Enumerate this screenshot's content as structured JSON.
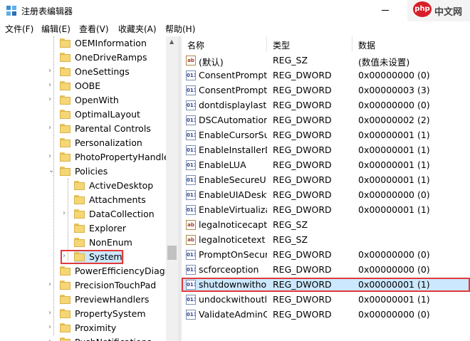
{
  "window": {
    "title": "注册表编辑器"
  },
  "brand": {
    "logo": "php",
    "text": "中文网"
  },
  "menu": [
    "文件(F)",
    "编辑(E)",
    "查看(V)",
    "收藏夹(A)",
    "帮助(H)"
  ],
  "tree": [
    {
      "label": "OEMInformation",
      "level": 1,
      "expander": ""
    },
    {
      "label": "OneDriveRamps",
      "level": 1,
      "expander": ""
    },
    {
      "label": "OneSettings",
      "level": 1,
      "expander": ">"
    },
    {
      "label": "OOBE",
      "level": 1,
      "expander": ">"
    },
    {
      "label": "OpenWith",
      "level": 1,
      "expander": ">"
    },
    {
      "label": "OptimalLayout",
      "level": 1,
      "expander": ""
    },
    {
      "label": "Parental Controls",
      "level": 1,
      "expander": ">"
    },
    {
      "label": "Personalization",
      "level": 1,
      "expander": ""
    },
    {
      "label": "PhotoPropertyHandler",
      "level": 1,
      "expander": ">"
    },
    {
      "label": "Policies",
      "level": 1,
      "expander": "v"
    },
    {
      "label": "ActiveDesktop",
      "level": 2,
      "expander": ""
    },
    {
      "label": "Attachments",
      "level": 2,
      "expander": ""
    },
    {
      "label": "DataCollection",
      "level": 2,
      "expander": ">"
    },
    {
      "label": "Explorer",
      "level": 2,
      "expander": ""
    },
    {
      "label": "NonEnum",
      "level": 2,
      "expander": ""
    },
    {
      "label": "System",
      "level": 2,
      "expander": ">",
      "selected": true
    },
    {
      "label": "PowerEfficiencyDiagnostics",
      "level": 1,
      "expander": ""
    },
    {
      "label": "PrecisionTouchPad",
      "level": 1,
      "expander": ">"
    },
    {
      "label": "PreviewHandlers",
      "level": 1,
      "expander": ""
    },
    {
      "label": "PropertySystem",
      "level": 1,
      "expander": ">"
    },
    {
      "label": "Proximity",
      "level": 1,
      "expander": ">"
    },
    {
      "label": "PushNotifications",
      "level": 1,
      "expander": ">"
    }
  ],
  "columns": {
    "name": "名称",
    "type": "类型",
    "data": "数据"
  },
  "values": [
    {
      "name": "(默认)",
      "type": "REG_SZ",
      "data": "(数值未设置)",
      "kind": "sz"
    },
    {
      "name": "ConsentPromptBehaviorAdmin",
      "type": "REG_DWORD",
      "data": "0x00000000 (0)",
      "kind": "dword"
    },
    {
      "name": "ConsentPromptBehaviorUser",
      "type": "REG_DWORD",
      "data": "0x00000003 (3)",
      "kind": "dword"
    },
    {
      "name": "dontdisplaylastusername",
      "type": "REG_DWORD",
      "data": "0x00000000 (0)",
      "kind": "dword"
    },
    {
      "name": "DSCAutomationHostEnabled",
      "type": "REG_DWORD",
      "data": "0x00000002 (2)",
      "kind": "dword"
    },
    {
      "name": "EnableCursorSuppression",
      "type": "REG_DWORD",
      "data": "0x00000001 (1)",
      "kind": "dword"
    },
    {
      "name": "EnableInstallerDetection",
      "type": "REG_DWORD",
      "data": "0x00000001 (1)",
      "kind": "dword"
    },
    {
      "name": "EnableLUA",
      "type": "REG_DWORD",
      "data": "0x00000001 (1)",
      "kind": "dword"
    },
    {
      "name": "EnableSecureUIAPaths",
      "type": "REG_DWORD",
      "data": "0x00000001 (1)",
      "kind": "dword"
    },
    {
      "name": "EnableUIADesktopToggle",
      "type": "REG_DWORD",
      "data": "0x00000000 (0)",
      "kind": "dword"
    },
    {
      "name": "EnableVirtualization",
      "type": "REG_DWORD",
      "data": "0x00000001 (1)",
      "kind": "dword"
    },
    {
      "name": "legalnoticecaption",
      "type": "REG_SZ",
      "data": "",
      "kind": "sz"
    },
    {
      "name": "legalnoticetext",
      "type": "REG_SZ",
      "data": "",
      "kind": "sz"
    },
    {
      "name": "PromptOnSecureDesktop",
      "type": "REG_DWORD",
      "data": "0x00000000 (0)",
      "kind": "dword"
    },
    {
      "name": "scforceoption",
      "type": "REG_DWORD",
      "data": "0x00000000 (0)",
      "kind": "dword"
    },
    {
      "name": "shutdownwithoutlogon",
      "type": "REG_DWORD",
      "data": "0x00000001 (1)",
      "kind": "dword",
      "selected": true
    },
    {
      "name": "undockwithoutlogon",
      "type": "REG_DWORD",
      "data": "0x00000001 (1)",
      "kind": "dword"
    },
    {
      "name": "ValidateAdminCodeSignatures",
      "type": "REG_DWORD",
      "data": "0x00000000 (0)",
      "kind": "dword"
    }
  ]
}
